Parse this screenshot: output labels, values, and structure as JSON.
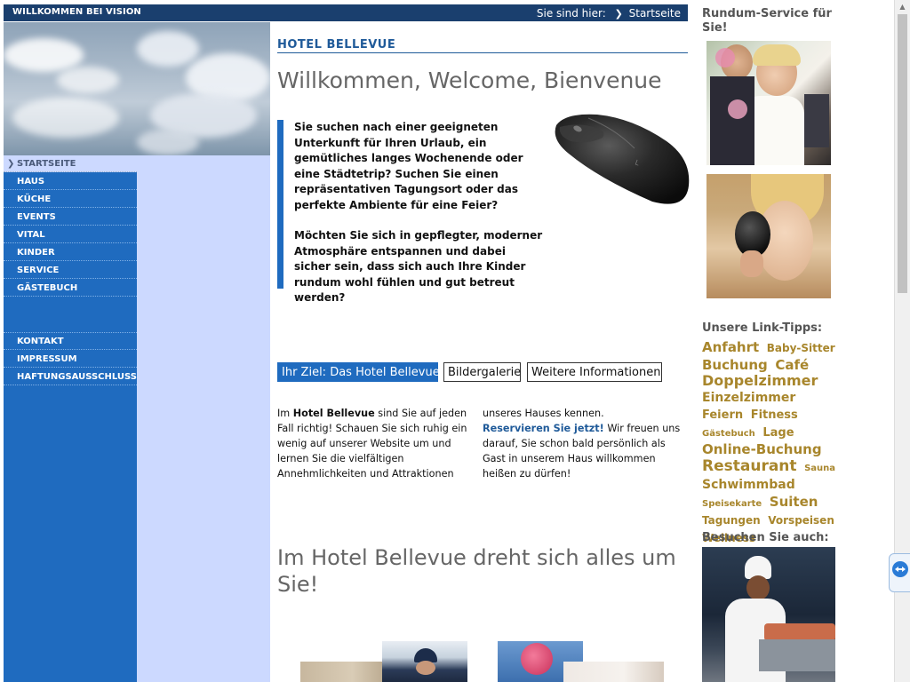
{
  "header": {
    "brand": "WILLKOMMEN BEI VISION",
    "breadcrumb_prefix": "Sie sind hier:",
    "breadcrumb_current": "Startseite"
  },
  "nav": {
    "active": "STARTSEITE",
    "items": [
      "HAUS",
      "KÜCHE",
      "EVENTS",
      "VITAL",
      "KINDER",
      "SERVICE",
      "GÄSTEBUCH"
    ],
    "secondary": [
      "KONTAKT",
      "IMPRESSUM",
      "HAFTUNGSAUSSCHLUSS"
    ]
  },
  "main": {
    "hotel_title": "HOTEL BELLEVUE",
    "welcome": "Willkommen, Welcome, Bienvenue",
    "intro_p1": "Sie suchen nach einer geeigneten Unterkunft für Ihren Urlaub, ein gemütliches langes Wochenende oder eine Städtetrip? Suchen Sie einen repräsentativen Tagungsort oder das perfekte Ambiente für eine Feier?",
    "intro_p2": "Möchten Sie sich in gepflegter, moderner Atmosphäre entspannen und dabei sicher sein, dass sich auch Ihre Kinder rundum wohl fühlen und gut betreut werden?",
    "tabs": [
      "Ihr Ziel: Das Hotel Bellevue",
      "Bildergalerie",
      "Weitere Informationen"
    ],
    "body_pre": "Im ",
    "body_bold": "Hotel Bellevue",
    "body_rest": " sind Sie auf jeden Fall richtig! Schauen Sie sich ruhig ein wenig auf unserer Website um und lernen Sie die vielfältigen Annehmlichkeiten und Attraktionen",
    "col2_pre": "unseres Hauses kennen.",
    "reserve_link": "Reservieren Sie jetzt!",
    "col2_post": " Wir freuen uns darauf, Sie schon bald persönlich als Gast in unserem Haus willkommen heißen zu dürfen!",
    "heading2": "Im Hotel Bellevue dreht sich alles um Sie!"
  },
  "sidebar": {
    "service_heading": "Rundum-Service für Sie!",
    "links_heading": "Unsere Link-Tipps:",
    "visit_heading": "Besuchen Sie auch:",
    "tags": [
      {
        "t": "Anfahrt",
        "s": 15
      },
      {
        "t": "Baby-Sitter",
        "s": 12
      },
      {
        "t": "Buchung",
        "s": 15
      },
      {
        "t": "Café",
        "s": 15
      },
      {
        "t": "Doppelzimmer",
        "s": 16
      },
      {
        "t": "Einzelzimmer",
        "s": 14
      },
      {
        "t": "Feiern",
        "s": 13
      },
      {
        "t": "Fitness",
        "s": 13
      },
      {
        "t": "Gästebuch",
        "s": 10
      },
      {
        "t": "Lage",
        "s": 13
      },
      {
        "t": "Online-Buchung",
        "s": 15
      },
      {
        "t": "Restaurant",
        "s": 17
      },
      {
        "t": "Sauna",
        "s": 10
      },
      {
        "t": "Schwimmbad",
        "s": 14
      },
      {
        "t": "Speisekarte",
        "s": 10
      },
      {
        "t": "Suiten",
        "s": 15
      },
      {
        "t": "Tagungen",
        "s": 12
      },
      {
        "t": "Vorspeisen",
        "s": 12
      },
      {
        "t": "Wellness",
        "s": 12
      }
    ]
  },
  "colors": {
    "topbar": "#1a3f6e",
    "nav": "#1f6bbf",
    "nav_pale": "#ccd9ff",
    "heading_blue": "#1f5a99",
    "tag_gold": "#a8862c"
  }
}
